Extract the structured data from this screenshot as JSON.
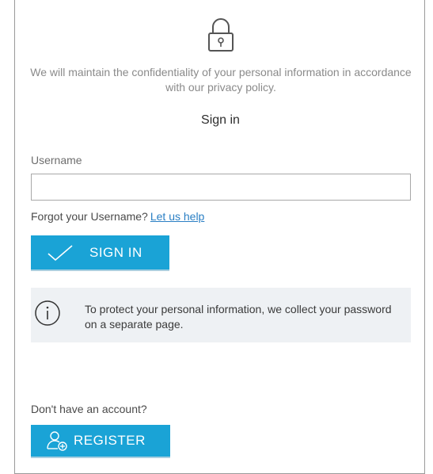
{
  "header": {
    "lock_icon": "padlock-icon",
    "privacy_text": "We will maintain the confidentiality of your personal information in accordance with our privacy policy.",
    "title": "Sign in"
  },
  "form": {
    "username_label": "Username",
    "username_value": "",
    "username_placeholder": "",
    "forgot_text": "Forgot your Username?",
    "forgot_link": "Let us help",
    "signin_label": "SIGN IN",
    "signin_icon": "checkmark-icon"
  },
  "info": {
    "icon": "info-icon",
    "text": "To protect your personal information, we collect your password on a separate page."
  },
  "register": {
    "prompt": "Don't have an account?",
    "label": "REGISTER",
    "icon": "add-user-icon"
  },
  "colors": {
    "accent": "#1aa3d6",
    "link": "#2a7fc4",
    "info_bg": "#eef1f4",
    "border": "#9a9a9a"
  }
}
